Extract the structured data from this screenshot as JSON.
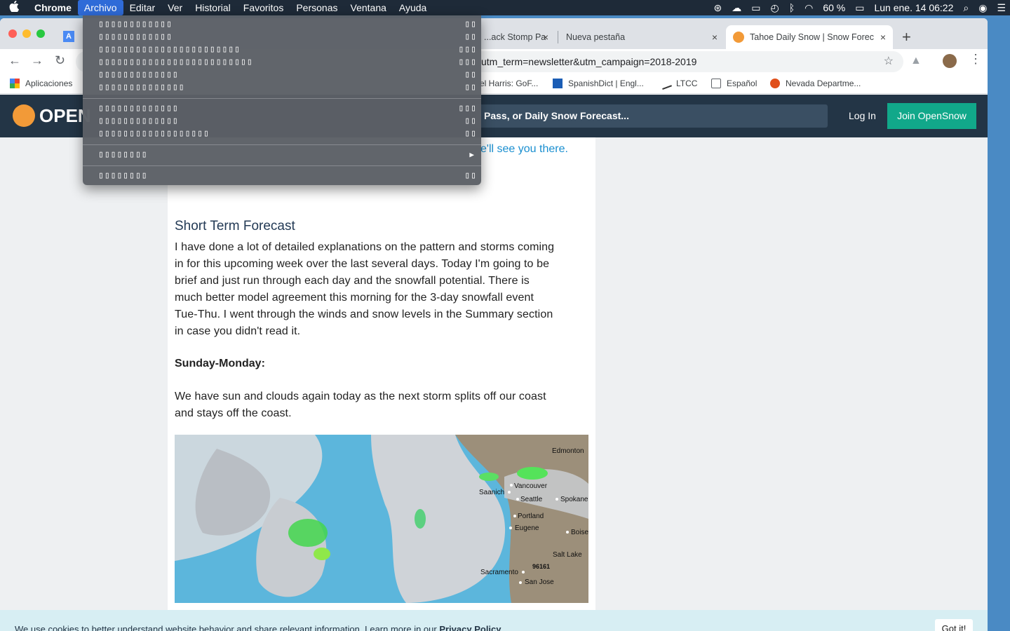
{
  "menubar": {
    "apple": "",
    "items": [
      "Chrome",
      "Archivo",
      "Editar",
      "Ver",
      "Historial",
      "Favoritos",
      "Personas",
      "Ventana",
      "Ayuda"
    ],
    "battery": "60 %",
    "datetime": "Lun ene. 14  06:22"
  },
  "tabs": [
    {
      "label": "...ack Stomp Pa",
      "close": "×"
    },
    {
      "label": "Nueva pestaña",
      "close": "×"
    },
    {
      "label": "Tahoe Daily Snow | Snow Forec",
      "close": "×"
    }
  ],
  "toolbar": {
    "url": "utm_term=newsletter&utm_campaign=2018-2019"
  },
  "bookmarks": [
    {
      "label": "Aplicaciones",
      "icon": "apps-grid-icon"
    },
    {
      "label": "el Harris: GoF...",
      "icon": "none"
    },
    {
      "label": "SpanishDict | Engl...",
      "icon": "spanishdict-icon"
    },
    {
      "label": "LTCC",
      "icon": "ltcc-icon"
    },
    {
      "label": "Español",
      "icon": "folder-icon"
    },
    {
      "label": "Nevada Departme...",
      "icon": "nevada-icon"
    }
  ],
  "site": {
    "logo": "OPEN",
    "search_placeholder": "Pass, or Daily Snow Forecast...",
    "login": "Log In",
    "join": "Join OpenSnow"
  },
  "article": {
    "top_link": "e'll see you there.",
    "heading": "Short Term Forecast",
    "paragraph1_lines": [
      "I have done a lot of detailed explanations on the pattern and storms coming",
      "in for this upcoming week over the last several days.  Today I'm going to be",
      "brief and just run through each day and the snowfall potential.  There is",
      "much better model agreement this morning for the 3-day snowfall event",
      "Tue-Thu.  I went through the winds and snow levels in the Summary section",
      "in case you didn't read it."
    ],
    "subheading": "Sunday-Monday:",
    "paragraph2_lines": [
      "We have sun and clouds again today as the next storm splits off our coast",
      "and stays off the coast."
    ],
    "map_labels": [
      "Edmonton",
      "Vancouver",
      "Saanich",
      "Seattle",
      "Spokane",
      "Portland",
      "Eugene",
      "Boise",
      "Salt Lake",
      "96161",
      "Sacramento",
      "San Jose"
    ]
  },
  "cookie": {
    "text": "We use cookies to better understand website behavior and share relevant information. Learn more in our ",
    "link": "Privacy Policy",
    "end": ".",
    "button": "Got it!"
  },
  "archivo_menu": {
    "group1": [
      {
        "label": "▯▯▯▯▯▯▯▯▯▯▯▯",
        "shortcut": "▯▯"
      },
      {
        "label": "▯▯▯▯▯▯▯▯▯▯▯▯",
        "shortcut": "▯▯"
      },
      {
        "label": "▯▯▯▯▯▯▯▯▯▯▯▯▯▯▯▯▯▯▯▯▯▯▯",
        "shortcut": "▯▯▯"
      },
      {
        "label": "▯▯▯▯▯▯▯▯▯▯▯▯▯▯▯▯▯▯▯▯▯▯▯▯▯",
        "shortcut": "▯▯▯"
      },
      {
        "label": "▯▯▯▯▯▯▯▯▯▯▯▯▯",
        "shortcut": "▯▯"
      },
      {
        "label": "▯▯▯▯▯▯▯▯▯▯▯▯▯▯",
        "shortcut": "▯▯"
      }
    ],
    "group2": [
      {
        "label": "▯▯▯▯▯▯▯▯▯▯▯▯▯",
        "shortcut": "▯▯▯"
      },
      {
        "label": "▯▯▯▯▯▯▯▯▯▯▯▯▯",
        "shortcut": "▯▯"
      },
      {
        "label": "▯▯▯▯▯▯▯▯▯▯▯▯▯▯▯▯▯▯",
        "shortcut": "▯▯"
      }
    ],
    "submenu": {
      "label": "▯▯▯▯▯▯▯▯",
      "arrow": "▶"
    },
    "last": {
      "label": "▯▯▯▯▯▯▯▯",
      "shortcut": "▯▯"
    }
  },
  "colors": {
    "accent": "#2f6bd8",
    "site_header": "#233546",
    "join_button": "#11a88a",
    "link": "#1a8fd0"
  }
}
